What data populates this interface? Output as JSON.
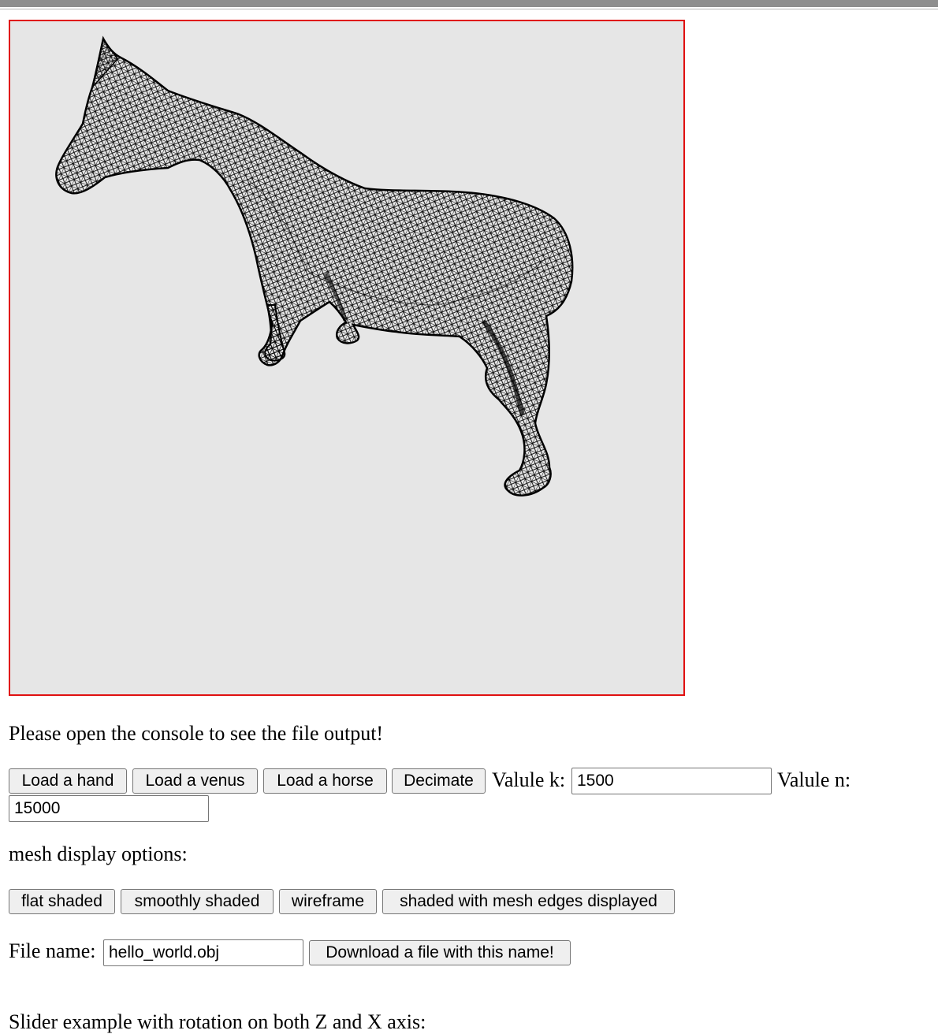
{
  "viewer": {
    "model": "horse",
    "display_mode": "wireframe",
    "background": "#e6e6e6",
    "border_color": "#e01010",
    "mesh_color": "#000000"
  },
  "console_note": "Please open the console to see the file output!",
  "loaders": {
    "hand_label": "Load a hand",
    "venus_label": "Load a venus",
    "horse_label": "Load a horse",
    "decimate_label": "Decimate",
    "k_label": "Valule k:",
    "k_value": "1500",
    "n_label": "Valule n:",
    "n_value": "15000"
  },
  "display_options": {
    "heading": "mesh display options:",
    "flat_label": "flat shaded",
    "smooth_label": "smoothly shaded",
    "wireframe_label": "wireframe",
    "edges_label": "shaded with mesh edges displayed"
  },
  "download": {
    "file_label": "File name:",
    "file_value": "hello_world.obj",
    "button_label": "Download a file with this name!"
  },
  "slider_heading": "Slider example with rotation on both Z and X axis:"
}
